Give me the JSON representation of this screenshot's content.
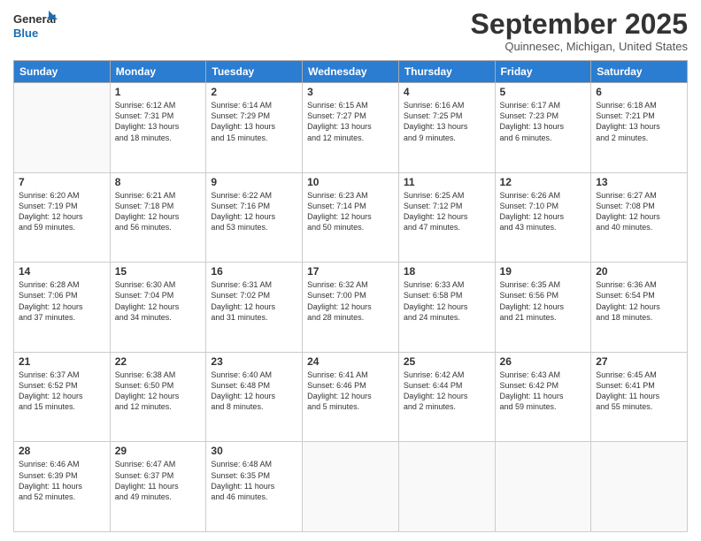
{
  "header": {
    "logo_line1": "General",
    "logo_line2": "Blue",
    "month": "September 2025",
    "location": "Quinnesec, Michigan, United States"
  },
  "weekdays": [
    "Sunday",
    "Monday",
    "Tuesday",
    "Wednesday",
    "Thursday",
    "Friday",
    "Saturday"
  ],
  "weeks": [
    [
      {
        "day": "",
        "info": ""
      },
      {
        "day": "1",
        "info": "Sunrise: 6:12 AM\nSunset: 7:31 PM\nDaylight: 13 hours\nand 18 minutes."
      },
      {
        "day": "2",
        "info": "Sunrise: 6:14 AM\nSunset: 7:29 PM\nDaylight: 13 hours\nand 15 minutes."
      },
      {
        "day": "3",
        "info": "Sunrise: 6:15 AM\nSunset: 7:27 PM\nDaylight: 13 hours\nand 12 minutes."
      },
      {
        "day": "4",
        "info": "Sunrise: 6:16 AM\nSunset: 7:25 PM\nDaylight: 13 hours\nand 9 minutes."
      },
      {
        "day": "5",
        "info": "Sunrise: 6:17 AM\nSunset: 7:23 PM\nDaylight: 13 hours\nand 6 minutes."
      },
      {
        "day": "6",
        "info": "Sunrise: 6:18 AM\nSunset: 7:21 PM\nDaylight: 13 hours\nand 2 minutes."
      }
    ],
    [
      {
        "day": "7",
        "info": "Sunrise: 6:20 AM\nSunset: 7:19 PM\nDaylight: 12 hours\nand 59 minutes."
      },
      {
        "day": "8",
        "info": "Sunrise: 6:21 AM\nSunset: 7:18 PM\nDaylight: 12 hours\nand 56 minutes."
      },
      {
        "day": "9",
        "info": "Sunrise: 6:22 AM\nSunset: 7:16 PM\nDaylight: 12 hours\nand 53 minutes."
      },
      {
        "day": "10",
        "info": "Sunrise: 6:23 AM\nSunset: 7:14 PM\nDaylight: 12 hours\nand 50 minutes."
      },
      {
        "day": "11",
        "info": "Sunrise: 6:25 AM\nSunset: 7:12 PM\nDaylight: 12 hours\nand 47 minutes."
      },
      {
        "day": "12",
        "info": "Sunrise: 6:26 AM\nSunset: 7:10 PM\nDaylight: 12 hours\nand 43 minutes."
      },
      {
        "day": "13",
        "info": "Sunrise: 6:27 AM\nSunset: 7:08 PM\nDaylight: 12 hours\nand 40 minutes."
      }
    ],
    [
      {
        "day": "14",
        "info": "Sunrise: 6:28 AM\nSunset: 7:06 PM\nDaylight: 12 hours\nand 37 minutes."
      },
      {
        "day": "15",
        "info": "Sunrise: 6:30 AM\nSunset: 7:04 PM\nDaylight: 12 hours\nand 34 minutes."
      },
      {
        "day": "16",
        "info": "Sunrise: 6:31 AM\nSunset: 7:02 PM\nDaylight: 12 hours\nand 31 minutes."
      },
      {
        "day": "17",
        "info": "Sunrise: 6:32 AM\nSunset: 7:00 PM\nDaylight: 12 hours\nand 28 minutes."
      },
      {
        "day": "18",
        "info": "Sunrise: 6:33 AM\nSunset: 6:58 PM\nDaylight: 12 hours\nand 24 minutes."
      },
      {
        "day": "19",
        "info": "Sunrise: 6:35 AM\nSunset: 6:56 PM\nDaylight: 12 hours\nand 21 minutes."
      },
      {
        "day": "20",
        "info": "Sunrise: 6:36 AM\nSunset: 6:54 PM\nDaylight: 12 hours\nand 18 minutes."
      }
    ],
    [
      {
        "day": "21",
        "info": "Sunrise: 6:37 AM\nSunset: 6:52 PM\nDaylight: 12 hours\nand 15 minutes."
      },
      {
        "day": "22",
        "info": "Sunrise: 6:38 AM\nSunset: 6:50 PM\nDaylight: 12 hours\nand 12 minutes."
      },
      {
        "day": "23",
        "info": "Sunrise: 6:40 AM\nSunset: 6:48 PM\nDaylight: 12 hours\nand 8 minutes."
      },
      {
        "day": "24",
        "info": "Sunrise: 6:41 AM\nSunset: 6:46 PM\nDaylight: 12 hours\nand 5 minutes."
      },
      {
        "day": "25",
        "info": "Sunrise: 6:42 AM\nSunset: 6:44 PM\nDaylight: 12 hours\nand 2 minutes."
      },
      {
        "day": "26",
        "info": "Sunrise: 6:43 AM\nSunset: 6:42 PM\nDaylight: 11 hours\nand 59 minutes."
      },
      {
        "day": "27",
        "info": "Sunrise: 6:45 AM\nSunset: 6:41 PM\nDaylight: 11 hours\nand 55 minutes."
      }
    ],
    [
      {
        "day": "28",
        "info": "Sunrise: 6:46 AM\nSunset: 6:39 PM\nDaylight: 11 hours\nand 52 minutes."
      },
      {
        "day": "29",
        "info": "Sunrise: 6:47 AM\nSunset: 6:37 PM\nDaylight: 11 hours\nand 49 minutes."
      },
      {
        "day": "30",
        "info": "Sunrise: 6:48 AM\nSunset: 6:35 PM\nDaylight: 11 hours\nand 46 minutes."
      },
      {
        "day": "",
        "info": ""
      },
      {
        "day": "",
        "info": ""
      },
      {
        "day": "",
        "info": ""
      },
      {
        "day": "",
        "info": ""
      }
    ]
  ]
}
